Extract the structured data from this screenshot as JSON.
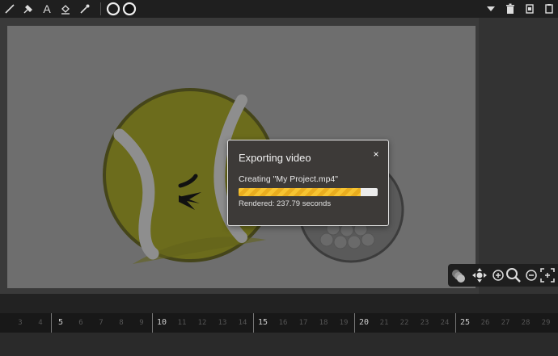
{
  "toolbar": {
    "left_icons": [
      "pencil-icon",
      "brush-icon",
      "text-icon",
      "paint-bucket-icon",
      "eyedropper-icon",
      "stroke-circle-icon",
      "fill-circle-icon"
    ],
    "text_tool_label": "A",
    "right_icons": [
      "dropdown-arrow-icon",
      "trash-icon",
      "copy-icon",
      "paste-icon"
    ]
  },
  "zoom_controls": [
    "onion-skin-icon",
    "move-icon",
    "zoom-in-icon",
    "zoom-magnifier-icon",
    "zoom-out-icon",
    "fit-screen-icon"
  ],
  "timeline": {
    "minor_frames": [
      "3",
      "4",
      "6",
      "7",
      "8",
      "9",
      "11",
      "12",
      "13",
      "14",
      "16",
      "17",
      "18",
      "19",
      "21",
      "22",
      "23",
      "24",
      "26",
      "27",
      "28",
      "29"
    ],
    "major_frames": [
      "5",
      "10",
      "15",
      "20",
      "25"
    ]
  },
  "dialog": {
    "title": "Exporting video",
    "close_label": "×",
    "status": "Creating \"My Project.mp4\"",
    "progress": 0.88,
    "rendered": "Rendered: 237.79 seconds"
  },
  "colors": {
    "accent": "#f7c432",
    "stage": "#6e6e6e",
    "tennis_ball": "#7a7a1a"
  }
}
